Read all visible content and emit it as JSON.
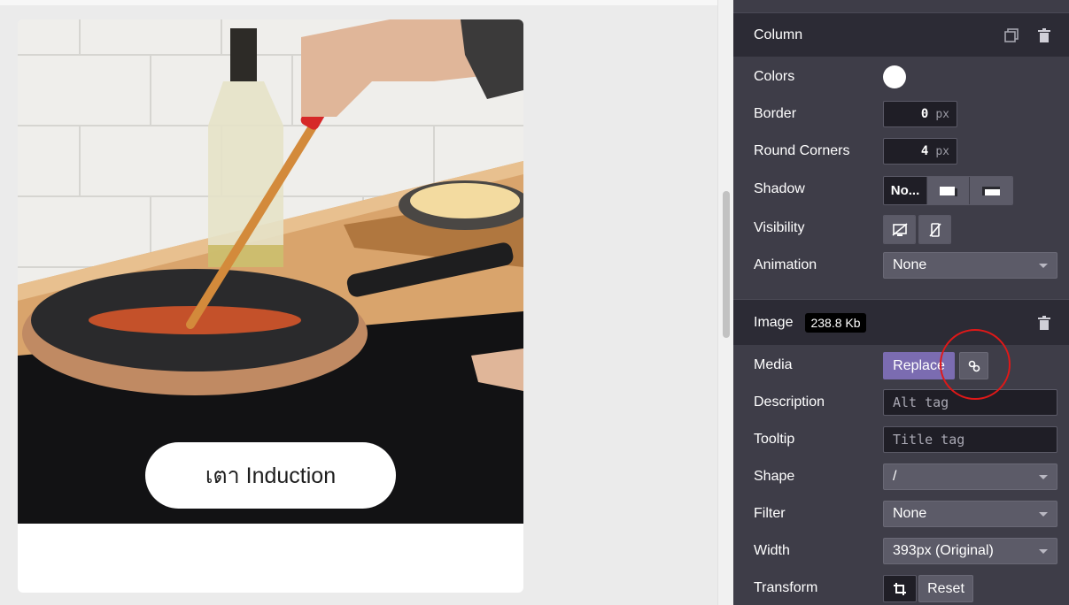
{
  "card": {
    "caption": "เตา Induction",
    "image_description_icon": "cooking-pan-photo"
  },
  "column_section": {
    "title": "Column",
    "rows": {
      "colors": {
        "label": "Colors",
        "value": "#ffffff"
      },
      "border": {
        "label": "Border",
        "value": "0",
        "unit": "px"
      },
      "round_corners": {
        "label": "Round Corners",
        "value": "4",
        "unit": "px"
      },
      "shadow": {
        "label": "Shadow",
        "options": [
          "No...",
          "outset-shadow-icon",
          "inset-shadow-icon"
        ]
      },
      "visibility": {
        "label": "Visibility"
      },
      "animation": {
        "label": "Animation",
        "value": "None"
      }
    }
  },
  "image_section": {
    "title": "Image",
    "size": "238.8 Kb",
    "rows": {
      "media": {
        "label": "Media",
        "replace_label": "Replace"
      },
      "description": {
        "label": "Description",
        "placeholder": "Alt tag"
      },
      "tooltip": {
        "label": "Tooltip",
        "placeholder": "Title tag"
      },
      "shape": {
        "label": "Shape",
        "value": "/"
      },
      "filter": {
        "label": "Filter",
        "value": "None"
      },
      "width": {
        "label": "Width",
        "value": "393px (Original)"
      },
      "transform": {
        "label": "Transform",
        "reset_label": "Reset"
      }
    }
  },
  "colors": {
    "panel_bg": "#3e3d48",
    "panel_header_bg": "#2c2b35",
    "accent_purple": "#7b6cb1",
    "highlight_red": "#e01818"
  }
}
